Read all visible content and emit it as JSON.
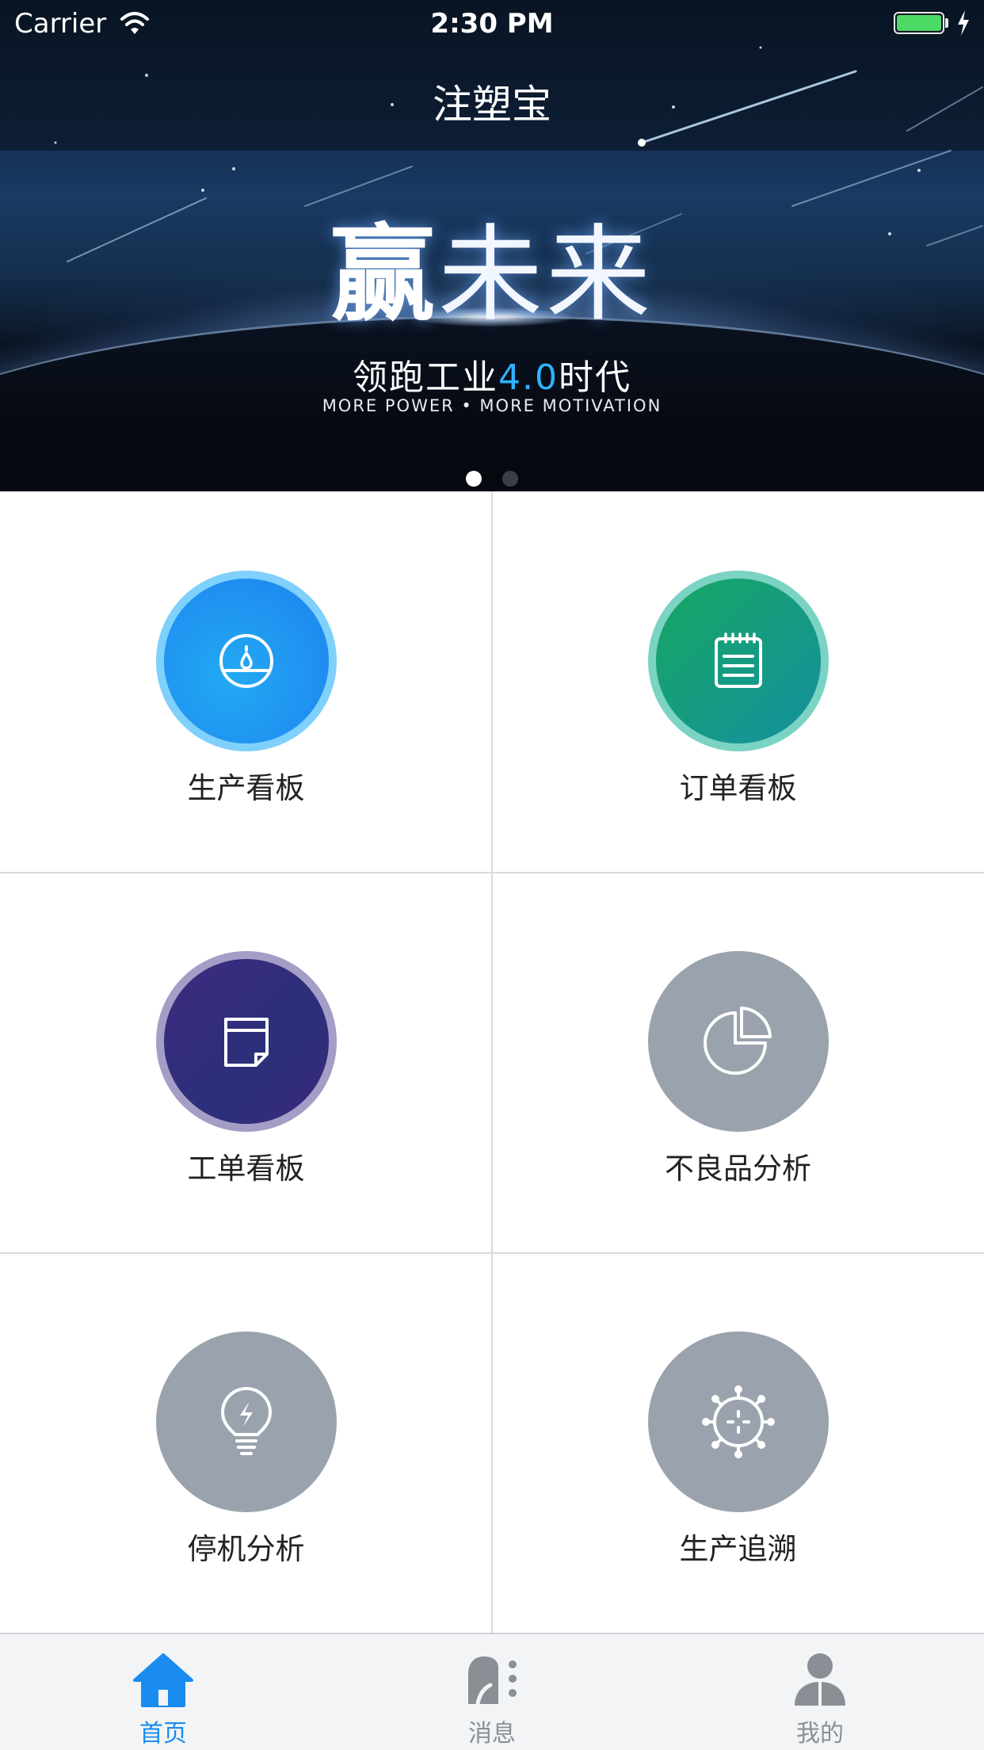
{
  "status_bar": {
    "carrier": "Carrier",
    "time": "2:30 PM",
    "battery_level": 1.0,
    "battery_color": "#4cd964"
  },
  "nav": {
    "title": "注塑宝"
  },
  "banner": {
    "slogan_strong": "赢",
    "slogan_thin": "未来",
    "subtitle_prefix": "领跑工业",
    "subtitle_accent": "4.0",
    "subtitle_suffix": "时代",
    "english": "MORE POWER • MORE MOTIVATION",
    "page_count": 2,
    "current_page": 1,
    "accent_color": "#2fb3ff"
  },
  "menu": {
    "items": [
      {
        "label": "生产看板",
        "icon": "dashboard-gauge-icon"
      },
      {
        "label": "订单看板",
        "icon": "notepad-icon"
      },
      {
        "label": "工单看板",
        "icon": "note-card-icon"
      },
      {
        "label": "不良品分析",
        "icon": "pie-chart-icon"
      },
      {
        "label": "停机分析",
        "icon": "lightbulb-bolt-icon"
      },
      {
        "label": "生产追溯",
        "icon": "gear-crosshair-icon"
      }
    ]
  },
  "tabbar": {
    "active_color": "#1a8cf0",
    "inactive_color": "#8a8f96",
    "tabs": [
      {
        "label": "首页",
        "icon": "home-icon",
        "active": true
      },
      {
        "label": "消息",
        "icon": "message-icon",
        "active": false
      },
      {
        "label": "我的",
        "icon": "user-icon",
        "active": false
      }
    ]
  }
}
